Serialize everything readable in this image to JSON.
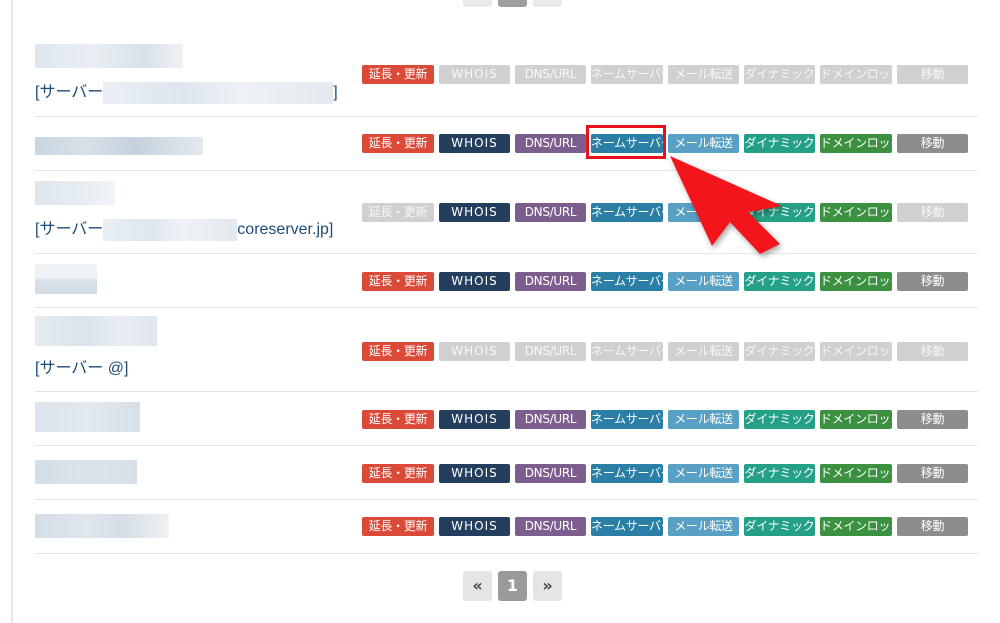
{
  "buttons": {
    "extend": "延長・更新",
    "whois": "WHOIS",
    "dns": "DNS/URL",
    "nameserver": "ネームサーバー",
    "mail": "メール転送",
    "dynamic": "ダイナミック",
    "lock": "ドメインロック",
    "move": "移動"
  },
  "rows": [
    {
      "server_prefix": "[サーバー",
      "server_suffix": "]",
      "enabled": [
        "extend"
      ]
    },
    {
      "server_prefix": "",
      "server_suffix": "",
      "enabled": [
        "extend",
        "whois",
        "dns",
        "nameserver",
        "mail",
        "dynamic",
        "lock",
        "move"
      ]
    },
    {
      "server_prefix": "[サーバー",
      "server_suffix": "coreserver.jp]",
      "enabled": [
        "whois",
        "dns",
        "nameserver",
        "mail",
        "dynamic",
        "lock"
      ]
    },
    {
      "server_prefix": "",
      "server_suffix": "",
      "enabled": [
        "extend",
        "whois",
        "dns",
        "nameserver",
        "mail",
        "dynamic",
        "lock",
        "move"
      ]
    },
    {
      "server_prefix": "[サーバー @]",
      "server_suffix": "",
      "enabled": [
        "extend"
      ]
    },
    {
      "server_prefix": "",
      "server_suffix": "",
      "enabled": [
        "extend",
        "whois",
        "dns",
        "nameserver",
        "mail",
        "dynamic",
        "lock",
        "move"
      ]
    },
    {
      "server_prefix": "",
      "server_suffix": "",
      "enabled": [
        "extend",
        "whois",
        "dns",
        "nameserver",
        "mail",
        "dynamic",
        "lock",
        "move"
      ]
    },
    {
      "server_prefix": "",
      "server_suffix": "",
      "enabled": [
        "extend",
        "whois",
        "dns",
        "nameserver",
        "mail",
        "dynamic",
        "lock",
        "move"
      ]
    }
  ],
  "pagination": {
    "prev": "«",
    "current": "1",
    "next": "»"
  },
  "colors": {
    "extend": "#db4a39",
    "whois": "#243f5e",
    "dns": "#7b5d8e",
    "nameserver": "#2b7ea6",
    "mail": "#58a0c4",
    "dynamic": "#23a086",
    "lock": "#3b9140",
    "move": "#8d8d8d",
    "disabled": "#d0d0d0",
    "highlight": "#e8101a",
    "arrow": "#f2141c"
  }
}
